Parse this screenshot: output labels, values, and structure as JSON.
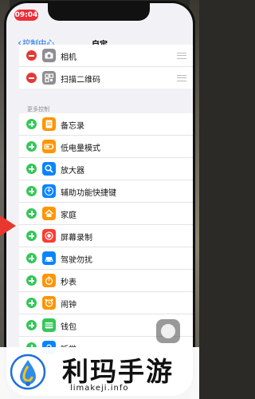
{
  "status_bar": {
    "time": "09:04"
  },
  "nav": {
    "back_label": "控制中心",
    "title": "自定"
  },
  "included_controls": [
    {
      "label": "相机",
      "icon": "camera-icon",
      "color": "#8e8e93"
    },
    {
      "label": "扫描二维码",
      "icon": "qr-code-icon",
      "color": "#8e8e93"
    }
  ],
  "more_controls": {
    "section_label": "更多控制",
    "items": [
      {
        "label": "备忘录",
        "icon": "notes-icon",
        "color": "#ff9500"
      },
      {
        "label": "低电量模式",
        "icon": "battery-icon",
        "color": "#ff9500"
      },
      {
        "label": "放大器",
        "icon": "magnifier-icon",
        "color": "#0a84ff"
      },
      {
        "label": "辅助功能快捷键",
        "icon": "accessibility-icon",
        "color": "#0a84ff"
      },
      {
        "label": "家庭",
        "icon": "home-icon",
        "color": "#ff9500"
      },
      {
        "label": "屏幕录制",
        "icon": "screen-record-icon",
        "color": "#ff3b30"
      },
      {
        "label": "驾驶勿扰",
        "icon": "car-icon",
        "color": "#0a84ff"
      },
      {
        "label": "秒表",
        "icon": "stopwatch-icon",
        "color": "#ff9500"
      },
      {
        "label": "闹钟",
        "icon": "alarm-icon",
        "color": "#ff9500"
      },
      {
        "label": "钱包",
        "icon": "wallet-icon",
        "color": "#34c759"
      },
      {
        "label": "听觉",
        "icon": "ear-icon",
        "color": "#0a84ff"
      }
    ]
  },
  "watermark": {
    "title": "利玛手游",
    "url": "limakeji.info"
  }
}
